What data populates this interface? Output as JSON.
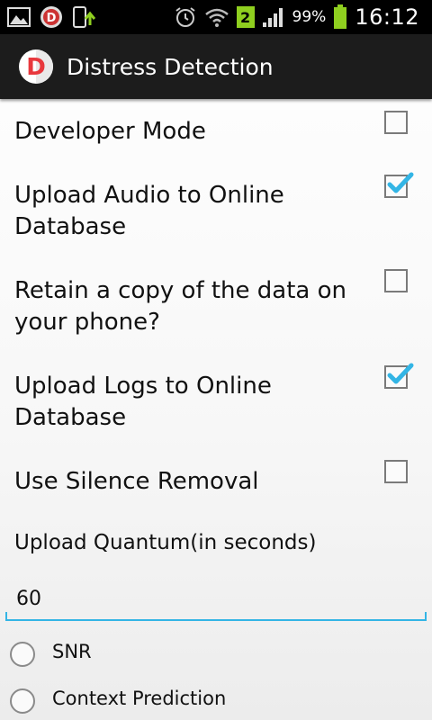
{
  "status_bar": {
    "notification_icons": [
      "gallery-icon",
      "distress-app-icon",
      "phone-upload-icon"
    ],
    "alarm_icon": "alarm-clock-icon",
    "wifi_icon": "wifi-icon",
    "badge_count": "2",
    "signal_icon": "signal-bars-icon",
    "battery_percent": "99%",
    "battery_icon": "battery-charging-icon",
    "time": "16:12"
  },
  "action_bar": {
    "logo_letter": "D",
    "title": "Distress Detection"
  },
  "preferences": [
    {
      "label": "Developer Mode",
      "checked": false
    },
    {
      "label": "Upload Audio to Online Database",
      "checked": true
    },
    {
      "label": "Retain a copy of the data on your phone?",
      "checked": false
    },
    {
      "label": "Upload Logs to Online Database",
      "checked": true
    },
    {
      "label": "Use Silence Removal",
      "checked": false
    }
  ],
  "upload_quantum": {
    "label": "Upload Quantum(in seconds)",
    "value": "60"
  },
  "radio_options": [
    {
      "label": "SNR",
      "selected": false
    },
    {
      "label": "Context Prediction",
      "selected": false
    }
  ],
  "colors": {
    "accent": "#33b5e5",
    "status_bar_bg": "#000000",
    "action_bar_bg": "#1c1c1c",
    "logo_red": "#e8383d",
    "badge_green": "#8fcf1f"
  }
}
